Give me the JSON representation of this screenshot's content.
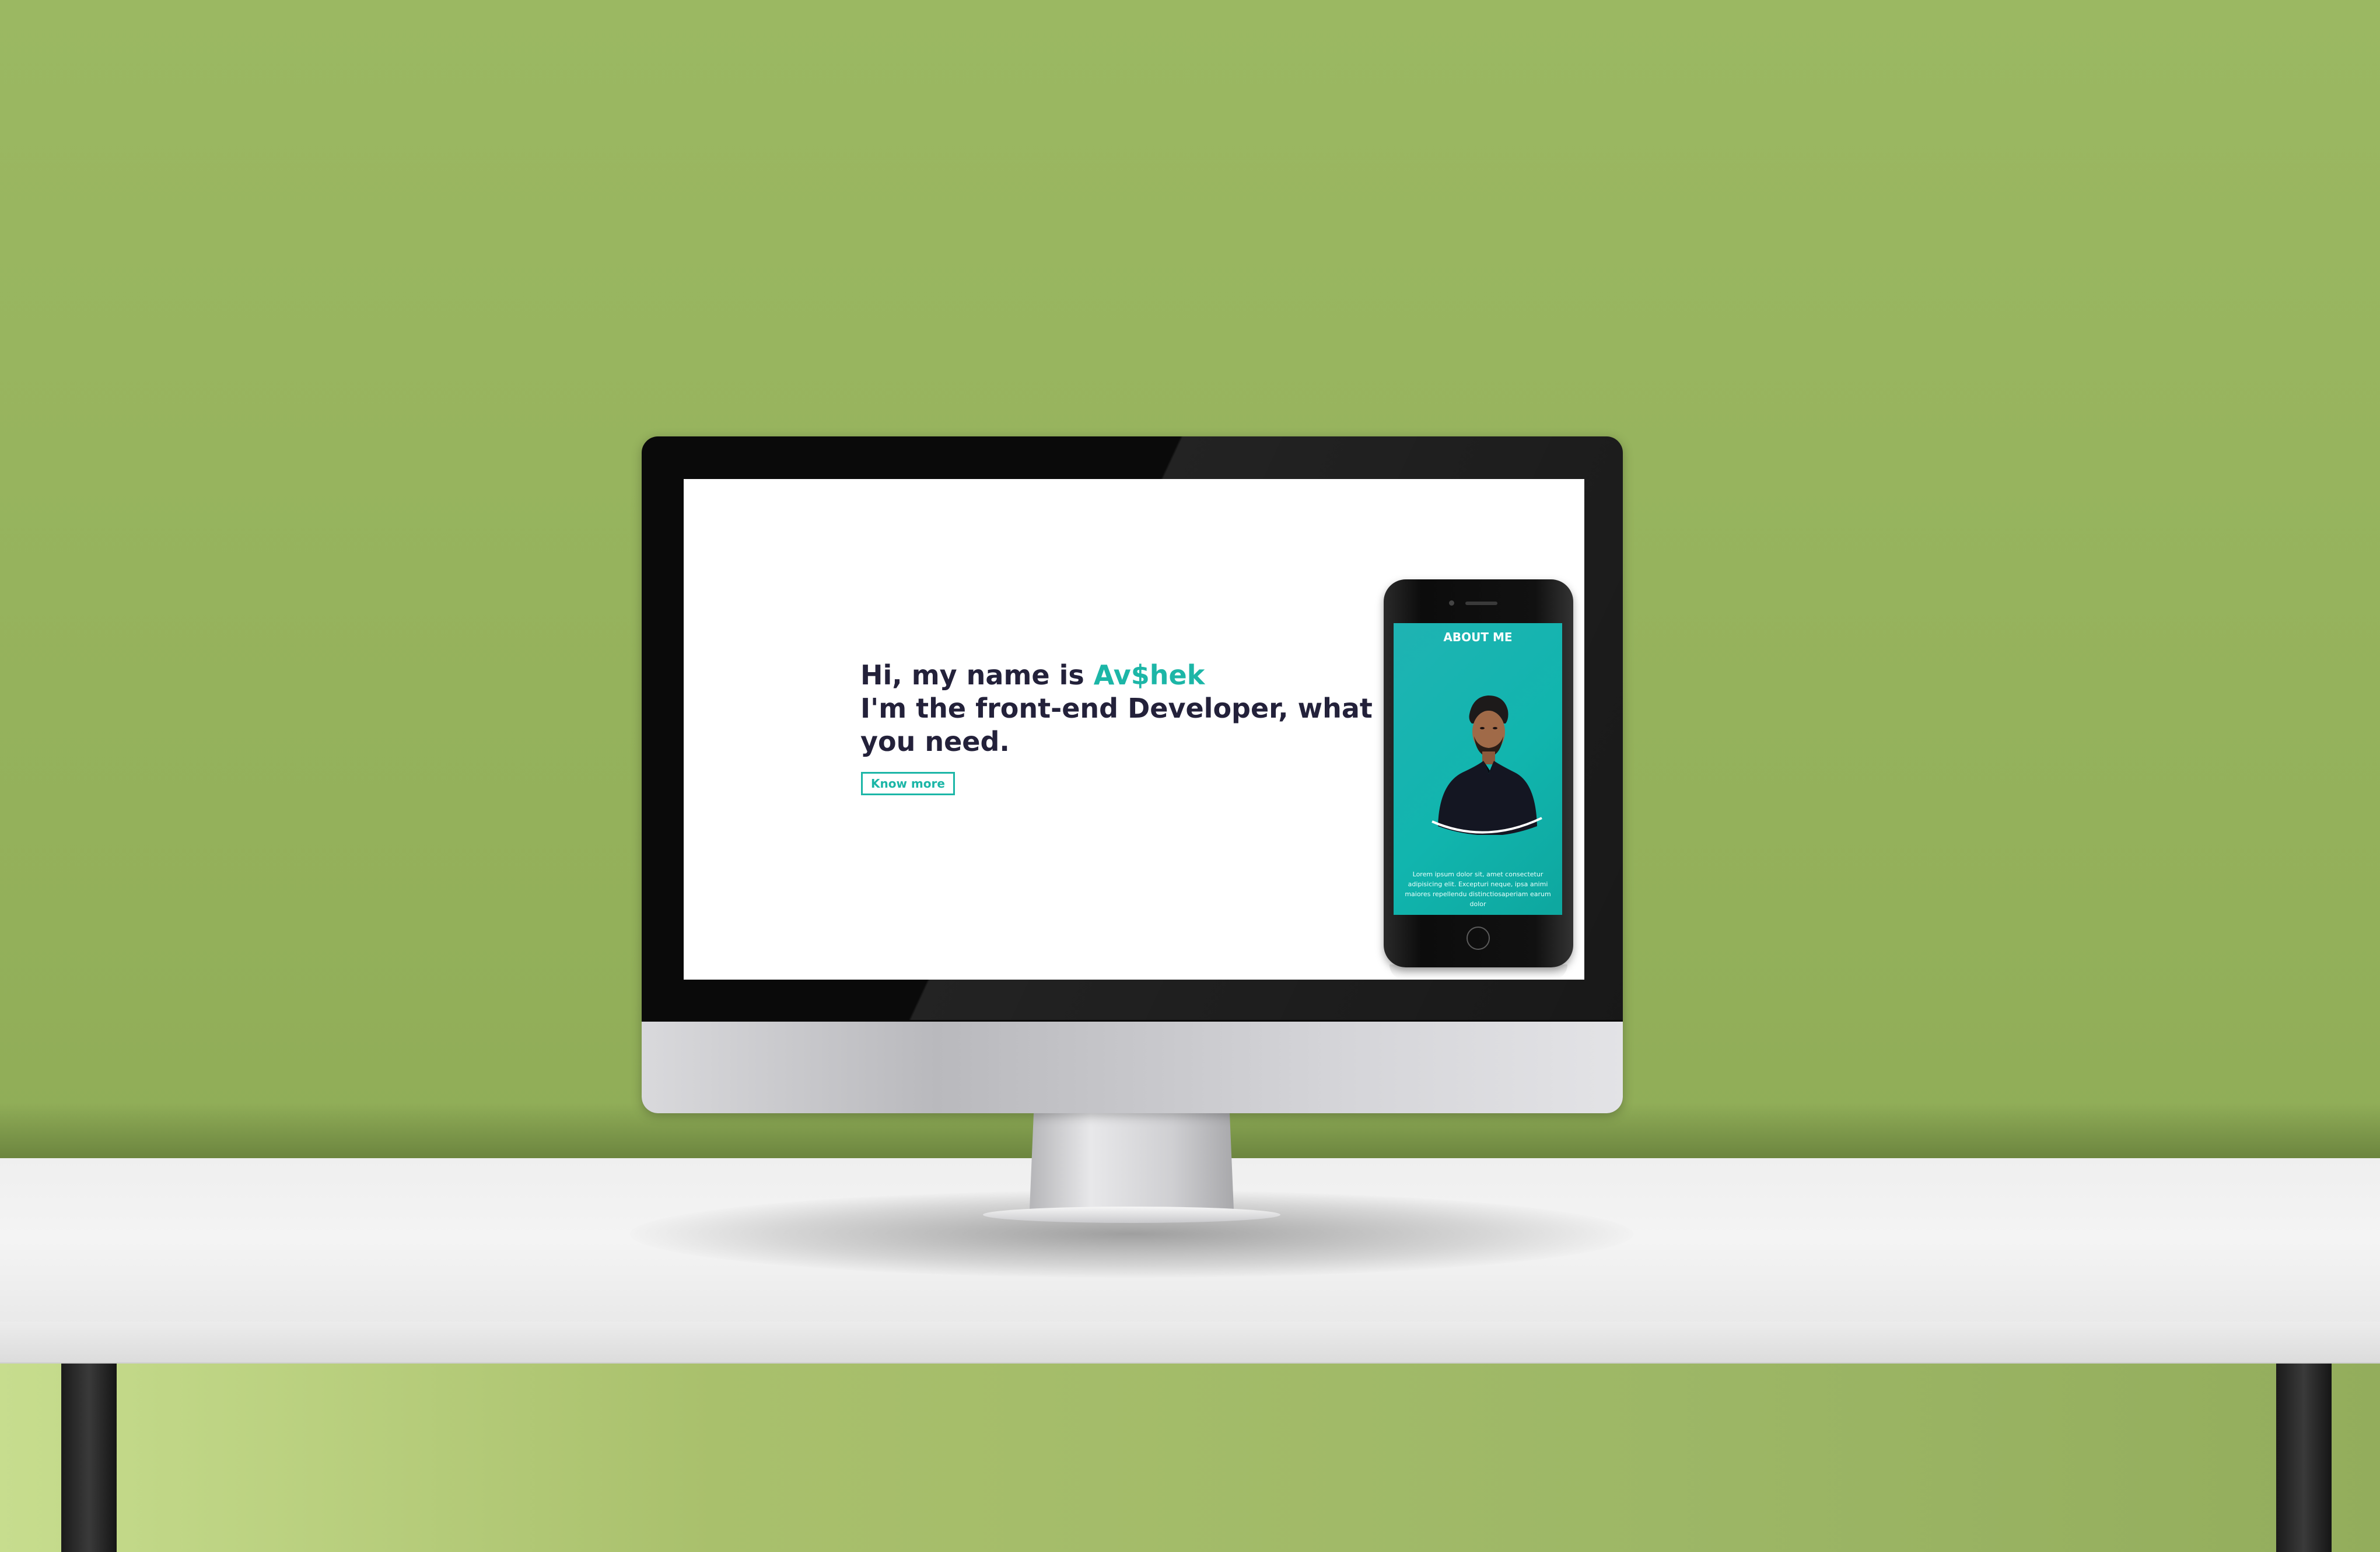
{
  "hero": {
    "line1_prefix": "Hi, my name is ",
    "name": "Av$hek",
    "line2": "I'm the front-end Developer, what you need.",
    "button_label": "Know more"
  },
  "phone": {
    "title": "ABOUT ME",
    "body": "Lorem ipsum dolor sit, amet consectetur adipisicing elit. Excepturi neque, ipsa animi maiores repellendu distinctiosaperiam earum dolor"
  },
  "colors": {
    "accent": "#1cb6a7",
    "heading": "#23213a",
    "wall": "#96b35d"
  }
}
